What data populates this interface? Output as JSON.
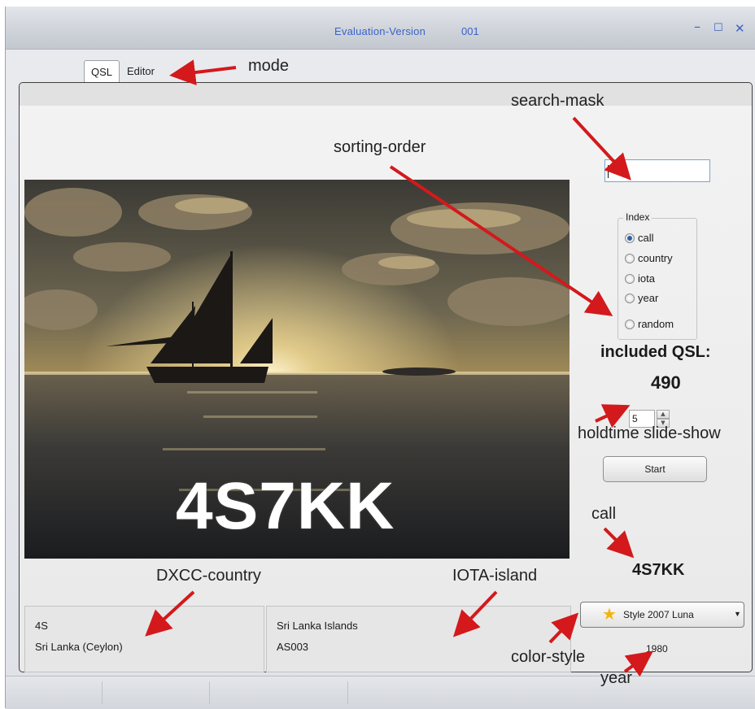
{
  "window": {
    "title": "Evaluation-Version",
    "version_number": "001",
    "minimize_glyph": "–",
    "maximize_glyph": "☐",
    "close_glyph": "✕"
  },
  "tabs": [
    {
      "label": "QSL",
      "active": true
    },
    {
      "label": "Editor",
      "active": false
    }
  ],
  "card": {
    "call_overlay": "4S7KK"
  },
  "search": {
    "value": ""
  },
  "index": {
    "legend": "Index",
    "options": [
      {
        "label": "call",
        "selected": true
      },
      {
        "label": "country",
        "selected": false
      },
      {
        "label": "iota",
        "selected": false
      },
      {
        "label": "year",
        "selected": false
      },
      {
        "label": "random",
        "selected": false
      }
    ]
  },
  "included": {
    "label": "included QSL:",
    "count": "490"
  },
  "holdtime": {
    "value": "5"
  },
  "start_button": {
    "label": "Start"
  },
  "current": {
    "call": "4S7KK",
    "dxcc_prefix": "4S",
    "dxcc_country": "Sri Lanka (Ceylon)",
    "iota_island": "Sri Lanka Islands",
    "iota_ref": "AS003",
    "year": "1980"
  },
  "style_combo": {
    "selected": "Style 2007 Luna",
    "icon": "star-icon"
  },
  "annotations": {
    "mode": "mode",
    "search_mask": "search-mask",
    "sorting_order": "sorting-order",
    "holdtime": "holdtime slide-show",
    "call": "call",
    "dxcc_country": "DXCC-country",
    "iota_island": "IOTA-island",
    "color_style": "color-style",
    "year": "year"
  },
  "colors": {
    "title_text": "#3b63c8",
    "annotation_arrow": "#d3191c",
    "radio_selected": "#2f5ea8"
  }
}
